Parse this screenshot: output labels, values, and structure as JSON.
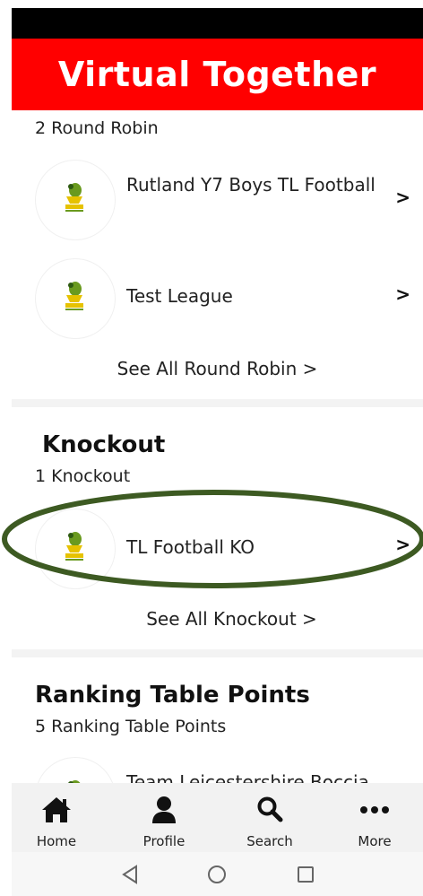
{
  "header": {
    "title": "Virtual Together"
  },
  "round_robin": {
    "count_text": "2 Round Robin",
    "items": [
      {
        "name": "Rutland Y7 Boys TL Football",
        "chevron": ">",
        "logo": "team-leicestershire-logo"
      },
      {
        "name": "Test League",
        "chevron": ">",
        "logo": "team-leicestershire-logo"
      }
    ],
    "see_all": "See All Round Robin >"
  },
  "knockout": {
    "title": "Knockout",
    "count_text": "1  Knockout",
    "items": [
      {
        "name": "TL Football KO",
        "chevron": ">",
        "logo": "team-leicestershire-logo"
      }
    ],
    "see_all": "See All  Knockout >"
  },
  "ranking": {
    "title": "Ranking Table Points",
    "count_text": "5 Ranking Table Points",
    "items": [
      {
        "name": "Team Leicestershire Boccia",
        "logo": "team-leicestershire-logo"
      }
    ]
  },
  "tabbar": {
    "tabs": [
      {
        "label": "Home",
        "icon": "home-icon"
      },
      {
        "label": "Profile",
        "icon": "profile-icon"
      },
      {
        "label": "Search",
        "icon": "search-icon"
      },
      {
        "label": "More",
        "icon": "more-icon"
      }
    ]
  },
  "android_nav": {
    "buttons": [
      "back-icon",
      "home-circle-icon",
      "recents-icon"
    ]
  },
  "colors": {
    "header_bg": "#ff0000",
    "annotation_ellipse": "#3d5a22",
    "logo_green": "#6a9a1f",
    "logo_yellow": "#e6c200"
  }
}
